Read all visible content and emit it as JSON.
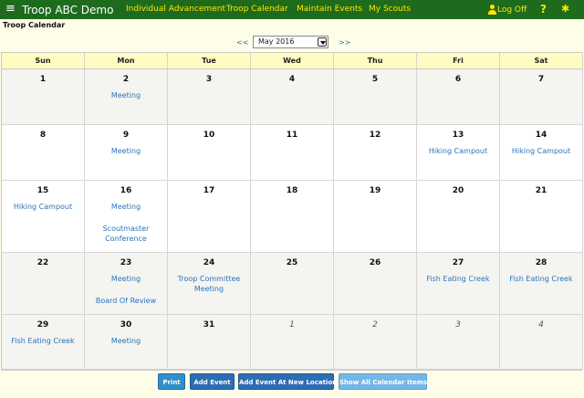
{
  "topbar": {
    "app_title": "Troop ABC Demo",
    "nav": [
      "Individual Advancement",
      "Troop Calendar",
      "Maintain Events",
      "My Scouts"
    ],
    "logoff": "Log Off",
    "help": "?",
    "icons": {
      "menu": "hamburger-icon",
      "user": "user-icon",
      "help": "help-icon",
      "settings": "gear-icon"
    }
  },
  "page_title": "Troop Calendar",
  "month_nav": {
    "prev": "<<",
    "selected_month": "May 2016",
    "next": ">>"
  },
  "calendar": {
    "weekdays": [
      "Sun",
      "Mon",
      "Tue",
      "Wed",
      "Thu",
      "Fri",
      "Sat"
    ],
    "weeks": [
      [
        {
          "day": "1",
          "events": []
        },
        {
          "day": "2",
          "events": [
            "Meeting"
          ]
        },
        {
          "day": "3",
          "events": []
        },
        {
          "day": "4",
          "events": []
        },
        {
          "day": "5",
          "events": []
        },
        {
          "day": "6",
          "events": []
        },
        {
          "day": "7",
          "events": []
        }
      ],
      [
        {
          "day": "8",
          "events": []
        },
        {
          "day": "9",
          "events": [
            "Meeting"
          ]
        },
        {
          "day": "10",
          "events": []
        },
        {
          "day": "11",
          "events": []
        },
        {
          "day": "12",
          "events": []
        },
        {
          "day": "13",
          "events": [
            "Hiking Campout"
          ]
        },
        {
          "day": "14",
          "events": [
            "Hiking Campout"
          ]
        }
      ],
      [
        {
          "day": "15",
          "events": [
            "Hiking Campout"
          ]
        },
        {
          "day": "16",
          "events": [
            "Meeting",
            "Scoutmaster Conference"
          ]
        },
        {
          "day": "17",
          "events": []
        },
        {
          "day": "18",
          "events": []
        },
        {
          "day": "19",
          "events": []
        },
        {
          "day": "20",
          "events": []
        },
        {
          "day": "21",
          "events": []
        }
      ],
      [
        {
          "day": "22",
          "events": []
        },
        {
          "day": "23",
          "events": [
            "Meeting",
            "Board Of Review"
          ]
        },
        {
          "day": "24",
          "events": [
            "Troop Committee Meeting"
          ]
        },
        {
          "day": "25",
          "events": []
        },
        {
          "day": "26",
          "events": []
        },
        {
          "day": "27",
          "events": [
            "Fish Eating Creek"
          ]
        },
        {
          "day": "28",
          "events": [
            "Fish Eating Creek"
          ]
        }
      ],
      [
        {
          "day": "29",
          "events": [
            "Fish Eating Creek"
          ]
        },
        {
          "day": "30",
          "events": [
            "Meeting"
          ]
        },
        {
          "day": "31",
          "events": []
        },
        {
          "day": "1",
          "events": [],
          "other_month": true
        },
        {
          "day": "2",
          "events": [],
          "other_month": true
        },
        {
          "day": "3",
          "events": [],
          "other_month": true
        },
        {
          "day": "4",
          "events": [],
          "other_month": true
        }
      ]
    ]
  },
  "buttons": {
    "print": "Print",
    "add_event": "Add Event",
    "add_event_location": "Add Event At New Location",
    "show_all": "Show All Calendar Items"
  }
}
